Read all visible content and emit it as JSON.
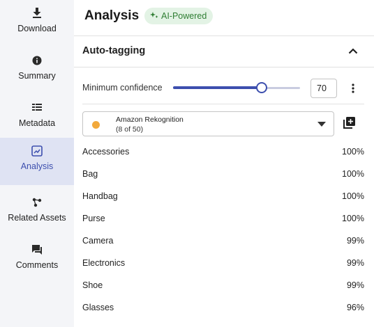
{
  "sidebar": {
    "items": [
      {
        "label": "Download",
        "icon": "download-icon",
        "active": false
      },
      {
        "label": "Summary",
        "icon": "info-icon",
        "active": false
      },
      {
        "label": "Metadata",
        "icon": "list-icon",
        "active": false
      },
      {
        "label": "Analysis",
        "icon": "analysis-icon",
        "active": true
      },
      {
        "label": "Related Assets",
        "icon": "graph-icon",
        "active": false
      },
      {
        "label": "Comments",
        "icon": "comment-icon",
        "active": false
      }
    ]
  },
  "header": {
    "title": "Analysis",
    "badge": "AI-Powered"
  },
  "section": {
    "title": "Auto-tagging",
    "expanded": true
  },
  "confidence": {
    "label": "Minimum confidence",
    "value": "70",
    "fraction": 0.7
  },
  "provider": {
    "name": "Amazon Rekognition",
    "count": "(8 of 50)",
    "dot_color": "#f2a93b"
  },
  "tags": [
    {
      "name": "Accessories",
      "score": "100%"
    },
    {
      "name": "Bag",
      "score": "100%"
    },
    {
      "name": "Handbag",
      "score": "100%"
    },
    {
      "name": "Purse",
      "score": "100%"
    },
    {
      "name": "Camera",
      "score": "99%"
    },
    {
      "name": "Electronics",
      "score": "99%"
    },
    {
      "name": "Shoe",
      "score": "99%"
    },
    {
      "name": "Glasses",
      "score": "96%"
    }
  ],
  "colors": {
    "accent": "#3d4fae",
    "badge_bg": "#e3f3e5",
    "badge_text": "#2e7d32"
  }
}
